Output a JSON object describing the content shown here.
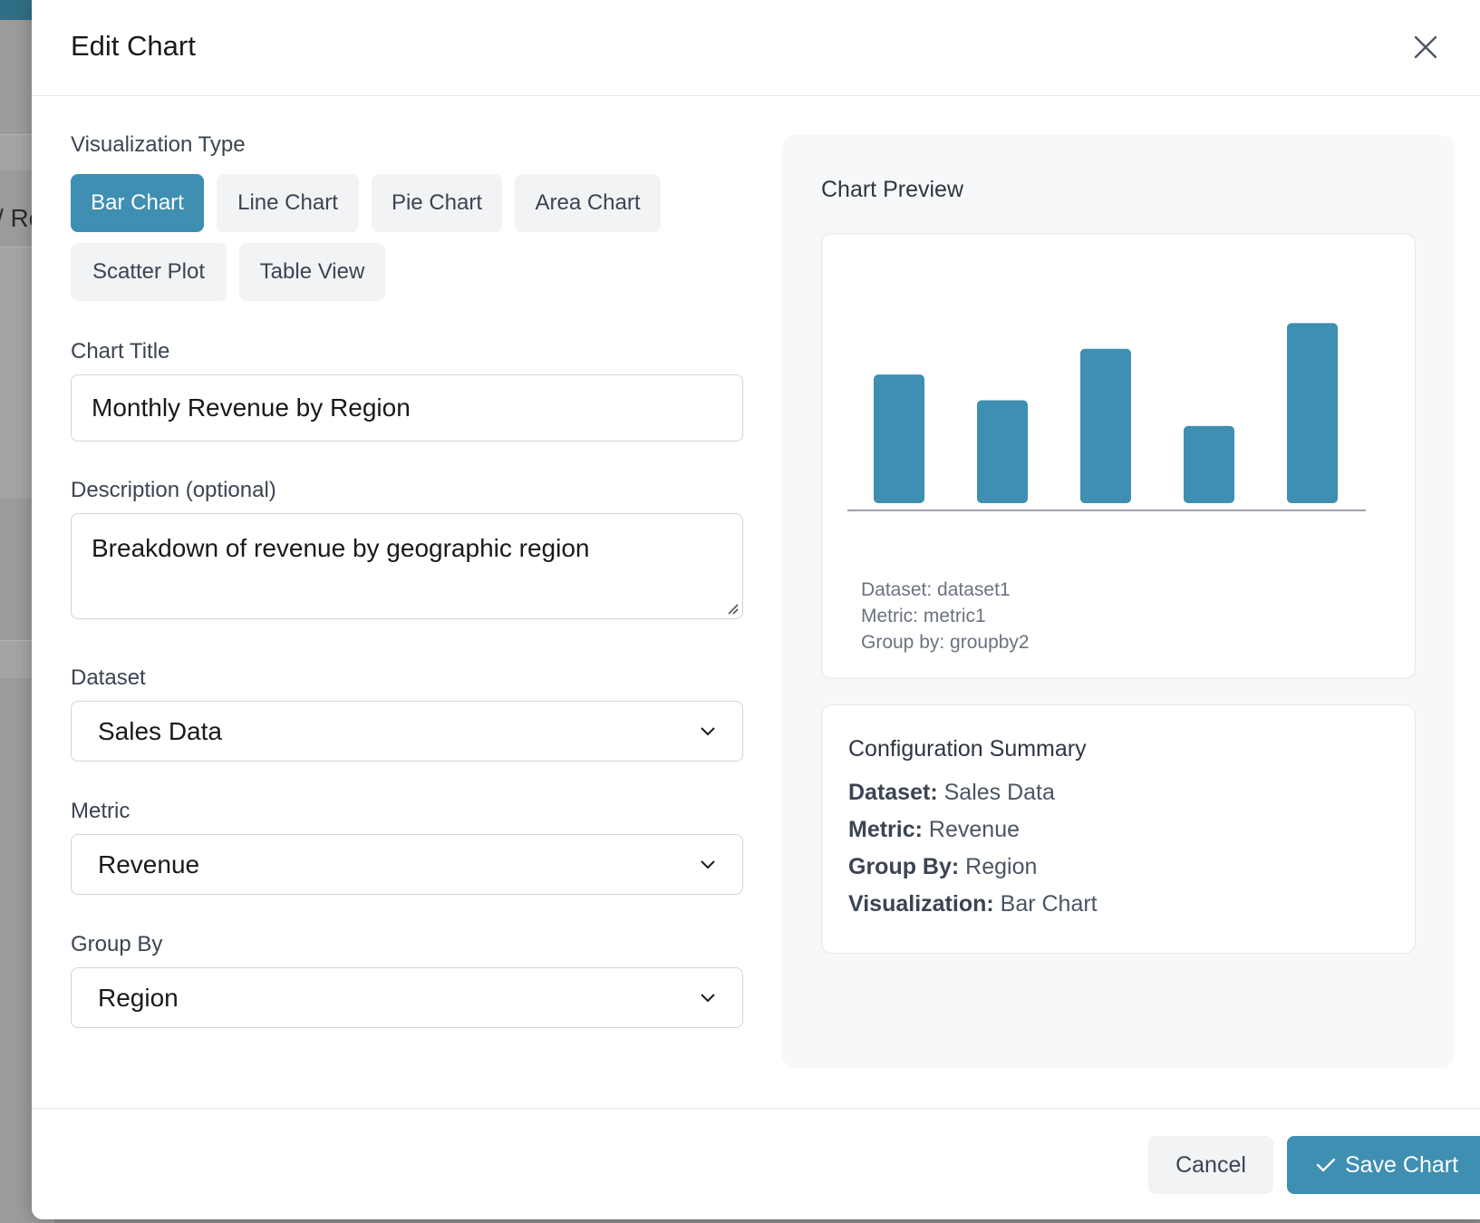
{
  "modal": {
    "title": "Edit Chart"
  },
  "visualization": {
    "label": "Visualization Type",
    "options": [
      {
        "label": "Bar Chart",
        "active": true
      },
      {
        "label": "Line Chart",
        "active": false
      },
      {
        "label": "Pie Chart",
        "active": false
      },
      {
        "label": "Area Chart",
        "active": false
      },
      {
        "label": "Scatter Plot",
        "active": false
      },
      {
        "label": "Table View",
        "active": false
      }
    ]
  },
  "fields": {
    "chart_title_label": "Chart Title",
    "chart_title_value": "Monthly Revenue by Region",
    "description_label": "Description (optional)",
    "description_value": "Breakdown of revenue by geographic region",
    "dataset_label": "Dataset",
    "dataset_value": "Sales Data",
    "metric_label": "Metric",
    "metric_value": "Revenue",
    "groupby_label": "Group By",
    "groupby_value": "Region"
  },
  "preview": {
    "title": "Chart Preview",
    "meta": [
      "Dataset: dataset1",
      "Metric: metric1",
      "Group by: groupby2"
    ]
  },
  "chart_data": {
    "type": "bar",
    "values": [
      5,
      4,
      6,
      3,
      7
    ],
    "ylim": [
      0,
      7.4
    ],
    "bar_color": "#3e8fb1"
  },
  "summary": {
    "title": "Configuration Summary",
    "rows": [
      {
        "key": "Dataset:",
        "value": "Sales Data"
      },
      {
        "key": "Metric:",
        "value": "Revenue"
      },
      {
        "key": "Group By:",
        "value": "Region"
      },
      {
        "key": "Visualization:",
        "value": "Bar Chart"
      }
    ]
  },
  "footer": {
    "cancel_label": "Cancel",
    "save_label": "Save Chart"
  },
  "colors": {
    "accent": "#3e8fb1"
  }
}
